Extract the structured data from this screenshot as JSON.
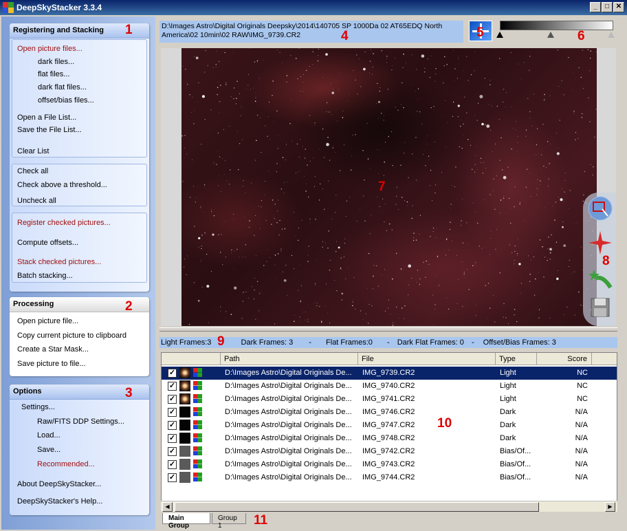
{
  "window": {
    "title": "DeepSkyStacker 3.3.4"
  },
  "registering": {
    "header": "Registering and Stacking",
    "open_picture_files": "Open picture files...",
    "dark_files": "dark files...",
    "flat_files": "flat files...",
    "dark_flat_files": "dark flat files...",
    "offset_bias_files": "offset/bias files...",
    "open_file_list": "Open a File List...",
    "save_file_list": "Save the File List...",
    "clear_list": "Clear List",
    "check_all": "Check all",
    "check_above_threshold": "Check above a threshold...",
    "uncheck_all": "Uncheck all",
    "register_checked": "Register checked pictures...",
    "compute_offsets": "Compute offsets...",
    "stack_checked": "Stack checked pictures...",
    "batch_stacking": "Batch stacking..."
  },
  "processing": {
    "header": "Processing",
    "open_picture_file": "Open picture file...",
    "copy_to_clipboard": "Copy current picture to clipboard",
    "create_star_mask": "Create a Star Mask...",
    "save_picture": "Save picture to file..."
  },
  "options": {
    "header": "Options",
    "settings": "Settings...",
    "raw_fits": "Raw/FITS DDP Settings...",
    "load": "Load...",
    "save": "Save...",
    "recommended": "Recommended...",
    "about": "About DeepSkyStacker...",
    "help": "DeepSkyStacker's Help..."
  },
  "markers": [
    "1",
    "2",
    "3",
    "4",
    "5",
    "6",
    "7",
    "8",
    "9",
    "10",
    "11"
  ],
  "image_path": "D:\\Images Astro\\Digital Originals Deepsky\\2014\\140705 SP 1000Da 02 AT65EDQ North America\\02 10min\\02 RAW\\IMG_9739.CR2",
  "frame_counts": {
    "light": "Light Frames:3",
    "dark": "Dark Frames: 3",
    "flat": "Flat Frames:0",
    "dark_flat": "Dark Flat Frames: 0",
    "offset_bias": "Offset/Bias Frames: 3",
    "sep": "-"
  },
  "table": {
    "columns": [
      "Path",
      "File",
      "Type",
      "Score"
    ],
    "rows": [
      {
        "path": "D:\\Images Astro\\Digital Originals De...",
        "file": "IMG_9739.CR2",
        "type": "Light",
        "score": "NC",
        "thumb": "light",
        "checked": true,
        "selected": true
      },
      {
        "path": "D:\\Images Astro\\Digital Originals De...",
        "file": "IMG_9740.CR2",
        "type": "Light",
        "score": "NC",
        "thumb": "light",
        "checked": true,
        "selected": false
      },
      {
        "path": "D:\\Images Astro\\Digital Originals De...",
        "file": "IMG_9741.CR2",
        "type": "Light",
        "score": "NC",
        "thumb": "light",
        "checked": true,
        "selected": false
      },
      {
        "path": "D:\\Images Astro\\Digital Originals De...",
        "file": "IMG_9746.CR2",
        "type": "Dark",
        "score": "N/A",
        "thumb": "dark",
        "checked": true,
        "selected": false
      },
      {
        "path": "D:\\Images Astro\\Digital Originals De...",
        "file": "IMG_9747.CR2",
        "type": "Dark",
        "score": "N/A",
        "thumb": "dark",
        "checked": true,
        "selected": false
      },
      {
        "path": "D:\\Images Astro\\Digital Originals De...",
        "file": "IMG_9748.CR2",
        "type": "Dark",
        "score": "N/A",
        "thumb": "dark",
        "checked": true,
        "selected": false
      },
      {
        "path": "D:\\Images Astro\\Digital Originals De...",
        "file": "IMG_9742.CR2",
        "type": "Bias/Of...",
        "score": "N/A",
        "thumb": "bias",
        "checked": true,
        "selected": false
      },
      {
        "path": "D:\\Images Astro\\Digital Originals De...",
        "file": "IMG_9743.CR2",
        "type": "Bias/Of...",
        "score": "N/A",
        "thumb": "bias",
        "checked": true,
        "selected": false
      },
      {
        "path": "D:\\Images Astro\\Digital Originals De...",
        "file": "IMG_9744.CR2",
        "type": "Bias/Of...",
        "score": "N/A",
        "thumb": "bias",
        "checked": true,
        "selected": false
      }
    ]
  },
  "tabs": [
    "Main Group",
    "Group 1"
  ],
  "window_buttons": {
    "minimize": "_",
    "maximize": "□",
    "close": "✕"
  },
  "colors": {
    "accent_red": "#a01010",
    "marker_red": "#e00000",
    "selection": "#0a246a"
  }
}
